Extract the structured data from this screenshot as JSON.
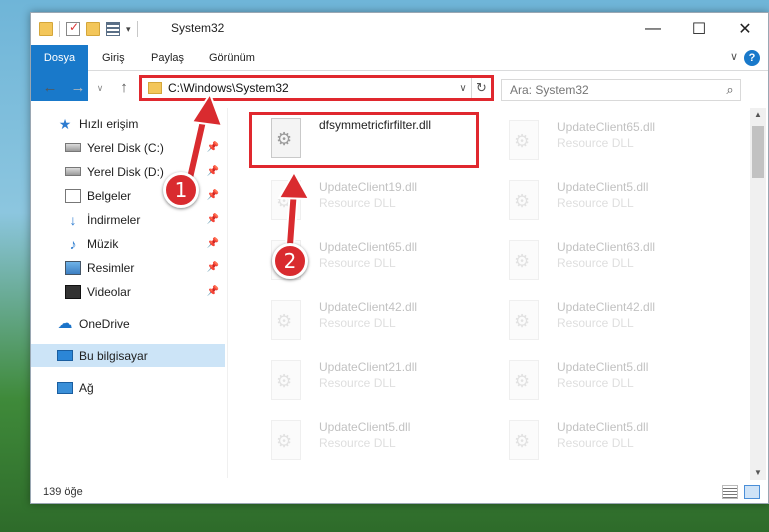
{
  "window": {
    "title": "System32",
    "controls": {
      "minimize": "—",
      "maximize": "☐",
      "close": "✕"
    }
  },
  "ribbon": {
    "tabs": [
      "Dosya",
      "Giriş",
      "Paylaş",
      "Görünüm"
    ],
    "help": "?",
    "collapse": "∨"
  },
  "navbar": {
    "back": "←",
    "forward": "→",
    "recent": "∨",
    "up": "↑",
    "address": "C:\\Windows\\System32",
    "address_dropdown": "∨",
    "refresh": "↻",
    "search_placeholder": "Ara: System32",
    "search_icon": "⌕"
  },
  "sidebar": {
    "items": [
      {
        "label": "Hızlı erişim",
        "icon": "star-icon",
        "pinned": false
      },
      {
        "label": "Yerel Disk (C:)",
        "icon": "disk-icon",
        "pinned": true
      },
      {
        "label": "Yerel Disk (D:)",
        "icon": "disk-icon",
        "pinned": true
      },
      {
        "label": "Belgeler",
        "icon": "documents-icon",
        "pinned": true
      },
      {
        "label": "İndirmeler",
        "icon": "download-icon",
        "pinned": true
      },
      {
        "label": "Müzik",
        "icon": "music-icon",
        "pinned": true
      },
      {
        "label": "Resimler",
        "icon": "pictures-icon",
        "pinned": true
      },
      {
        "label": "Videolar",
        "icon": "video-icon",
        "pinned": true
      },
      {
        "label": "OneDrive",
        "icon": "cloud-icon",
        "pinned": false
      },
      {
        "label": "Bu bilgisayar",
        "icon": "computer-icon",
        "pinned": false,
        "selected": true
      },
      {
        "label": "Ağ",
        "icon": "network-icon",
        "pinned": false
      }
    ],
    "pin_glyph": "📌"
  },
  "files": [
    {
      "name": "dfsymmetricfirfilter.dll",
      "type": "",
      "highlighted": true
    },
    {
      "name": "UpdateClient65.dll",
      "type": "Resource DLL"
    },
    {
      "name": "UpdateClient19.dll",
      "type": "Resource DLL"
    },
    {
      "name": "UpdateClient5.dll",
      "type": "Resource DLL"
    },
    {
      "name": "UpdateClient65.dll",
      "type": "Resource DLL"
    },
    {
      "name": "UpdateClient63.dll",
      "type": "Resource DLL"
    },
    {
      "name": "UpdateClient42.dll",
      "type": "Resource DLL"
    },
    {
      "name": "UpdateClient42.dll",
      "type": "Resource DLL"
    },
    {
      "name": "UpdateClient21.dll",
      "type": "Resource DLL"
    },
    {
      "name": "UpdateClient5.dll",
      "type": "Resource DLL"
    },
    {
      "name": "UpdateClient5.dll",
      "type": "Resource DLL"
    },
    {
      "name": "UpdateClient5.dll",
      "type": "Resource DLL"
    }
  ],
  "status": {
    "count": "139 öğe"
  },
  "annotations": {
    "badge1": "1",
    "badge2": "2",
    "color": "#d92b2f"
  },
  "scroll": {
    "up": "▲",
    "down": "▼"
  }
}
